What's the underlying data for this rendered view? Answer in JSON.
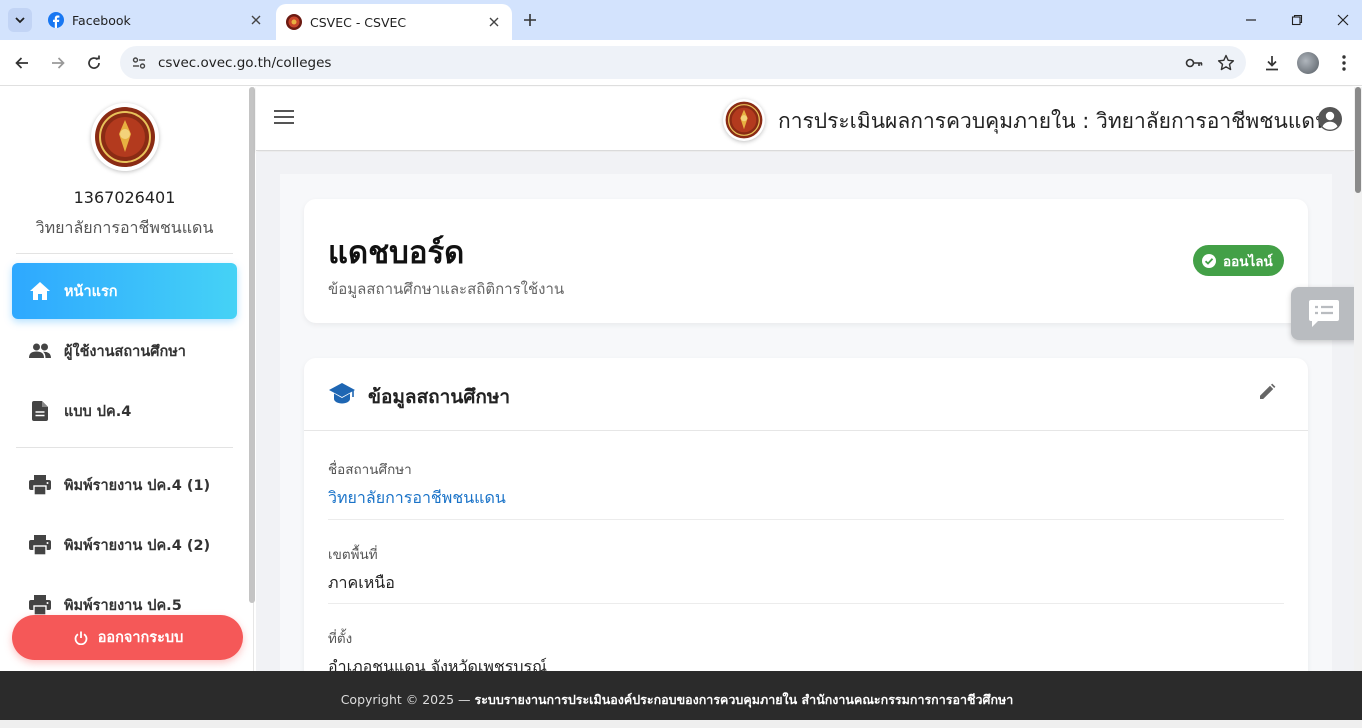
{
  "browser": {
    "tabs": [
      {
        "title": "Facebook",
        "favicon": "facebook-icon"
      },
      {
        "title": "CSVEC - CSVEC",
        "favicon": "ovec-seal-icon"
      }
    ],
    "url": "csvec.ovec.go.th/colleges"
  },
  "sidebar": {
    "code": "1367026401",
    "college_name": "วิทยาลัยการอาชีพชนแดน",
    "items": [
      {
        "label": "หน้าแรก",
        "icon": "home-icon"
      },
      {
        "label": "ผู้ใช้งานสถานศึกษา",
        "icon": "people-icon"
      },
      {
        "label": "แบบ ปค.4",
        "icon": "document-icon"
      },
      {
        "label": "พิมพ์รายงาน ปค.4 (1)",
        "icon": "printer-icon"
      },
      {
        "label": "พิมพ์รายงาน ปค.4 (2)",
        "icon": "printer-icon"
      },
      {
        "label": "พิมพ์รายงาน ปค.5",
        "icon": "printer-icon"
      }
    ],
    "logout_label": "ออกจากระบบ"
  },
  "appbar": {
    "title": "การประเมินผลการควบคุมภายใน : วิทยาลัยการอาชีพชนแดน"
  },
  "dashboard": {
    "title": "แดชบอร์ด",
    "subtitle": "ข้อมูลสถานศึกษาและสถิติการใช้งาน",
    "status": "ออนไลน์"
  },
  "college_info": {
    "heading": "ข้อมูลสถานศึกษา",
    "fields": [
      {
        "label": "ชื่อสถานศึกษา",
        "value": "วิทยาลัยการอาชีพชนแดน"
      },
      {
        "label": "เขตพื้นที่",
        "value": "ภาคเหนือ"
      },
      {
        "label": "ที่ตั้ง",
        "value": "อำเภอชนแดน จังหวัดเพชรบูรณ์"
      }
    ]
  },
  "footer": {
    "prefix": "Copyright © 2025 —",
    "text": "ระบบรายงานการประเมินองค์ประกอบของการควบคุมภายใน สำนักงานคณะกรรมการการอาชีวศึกษา"
  },
  "colors": {
    "accent_start": "#2ea8ff",
    "accent_end": "#45d2f6",
    "logout": "#f55858",
    "online": "#43a047",
    "link": "#1a73c8",
    "footer_bg": "#2b2b2b"
  }
}
